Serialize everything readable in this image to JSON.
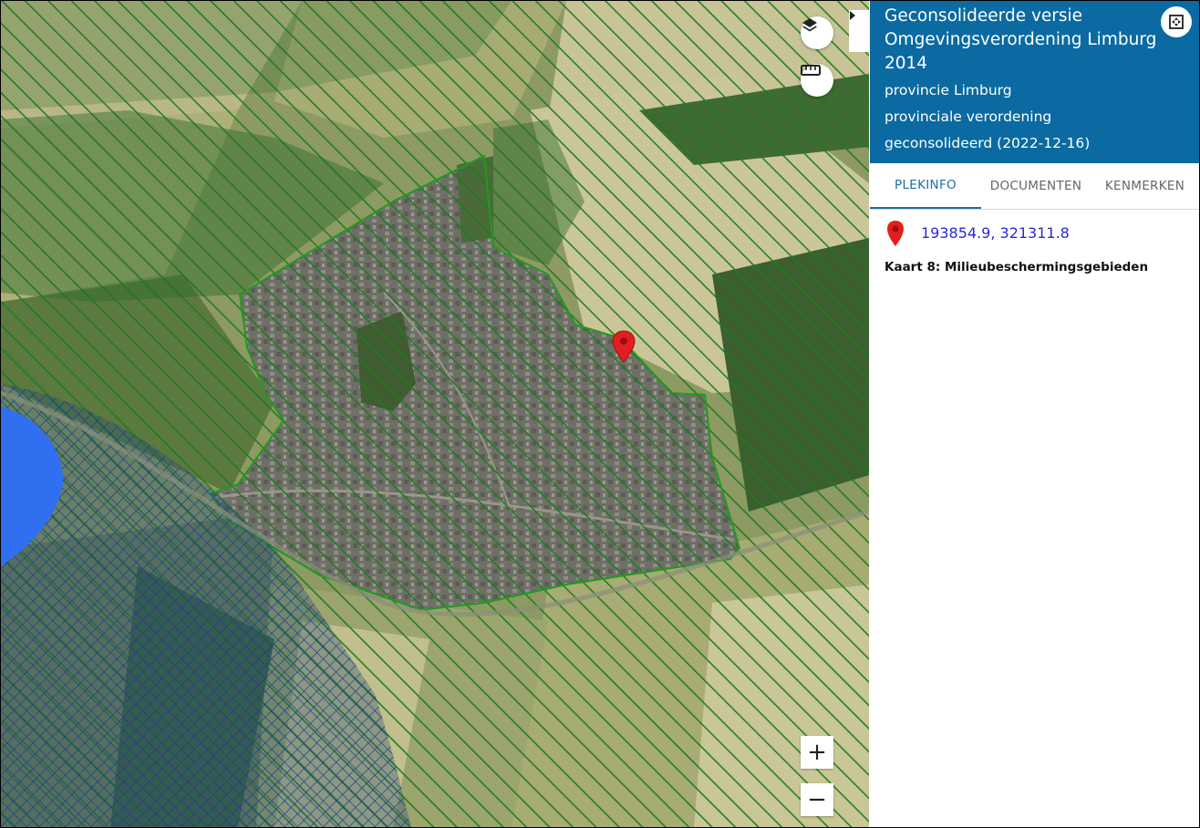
{
  "panel": {
    "title": "Geconsolideerde versie Omgevingsverordening Limburg 2014",
    "subtitle1": "provincie Limburg",
    "subtitle2": "provinciale verordening",
    "subtitle3": "geconsolideerd (2022-12-16)",
    "header_color": "#0a6aa1"
  },
  "tabs": [
    {
      "label": "PLEKINFO",
      "active": true
    },
    {
      "label": "DOCUMENTEN",
      "active": false
    },
    {
      "label": "KENMERKEN",
      "active": false
    }
  ],
  "location": {
    "coordinates": "193854.9, 321311.8",
    "map_layer": "Kaart 8: Milieubeschermingsgebieden"
  },
  "map": {
    "hatch_color": "#1f7a1f",
    "crosshatch_color": "#1a3f8a",
    "water_color": "#2f6ff0",
    "marker_color": "#e02020"
  },
  "controls": {
    "zoom_in": "+",
    "zoom_out": "−",
    "icons": [
      "layers-icon",
      "ruler-icon",
      "chevron-right-icon",
      "fullscreen-icon",
      "map-pin-icon"
    ]
  }
}
